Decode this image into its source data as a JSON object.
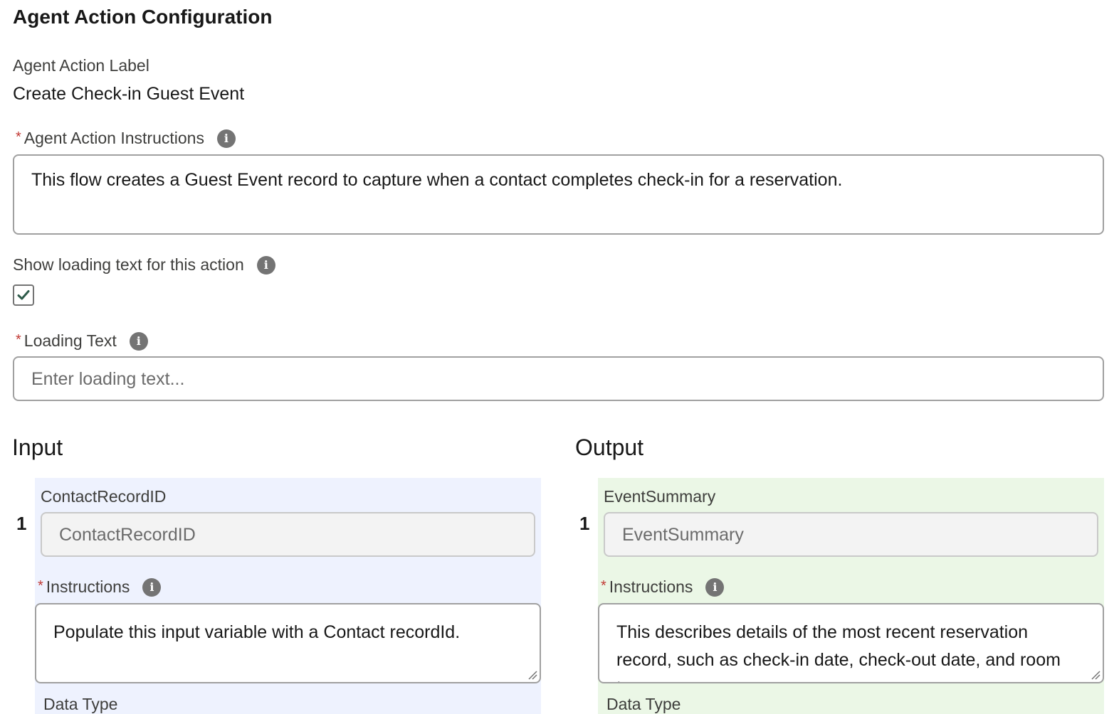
{
  "title": "Agent Action Configuration",
  "action_label": {
    "label": "Agent Action Label",
    "value": "Create Check-in Guest Event"
  },
  "action_instructions": {
    "required_mark": "*",
    "label": "Agent Action Instructions",
    "value": "This flow creates a Guest Event record to capture when a contact completes check-in for a reservation."
  },
  "loading_toggle": {
    "label": "Show loading text for this action",
    "checked": true
  },
  "loading_text": {
    "required_mark": "*",
    "label": "Loading Text",
    "placeholder": "Enter loading text..."
  },
  "input": {
    "heading": "Input",
    "items": [
      {
        "number": "1",
        "name_label": "ContactRecordID",
        "name_value": "ContactRecordID",
        "instructions_required": "*",
        "instructions_label": "Instructions",
        "instructions_value": "Populate this input variable with a Contact recordId.",
        "data_type_label": "Data Type"
      }
    ]
  },
  "output": {
    "heading": "Output",
    "items": [
      {
        "number": "1",
        "name_label": "EventSummary",
        "name_value": "EventSummary",
        "instructions_required": "*",
        "instructions_label": "Instructions",
        "instructions_value": "This describes details of the most recent reservation record, such as check-in date, check-out date, and room type.",
        "data_type_label": "Data Type"
      }
    ]
  },
  "icons": {
    "info": "info-icon",
    "check": "checkmark-icon",
    "resize": "resize-handle-icon"
  },
  "colors": {
    "required": "#c23934",
    "input_panel": "#eef2fe",
    "output_panel": "#ebf7e6",
    "checkmark": "#2e844a"
  }
}
